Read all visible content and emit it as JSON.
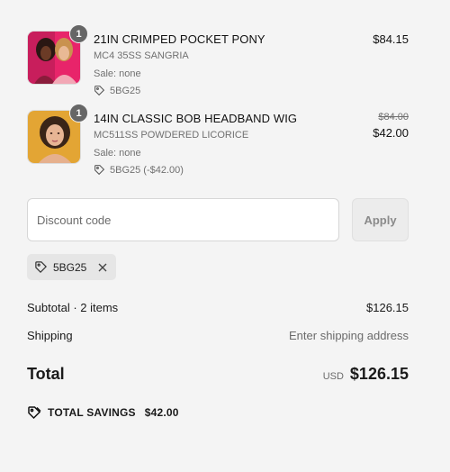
{
  "items": [
    {
      "name": "21IN CRIMPED POCKET PONY",
      "variant": "MC4 35SS SANGRIA",
      "sale": "Sale: none",
      "code": "5BG25",
      "quantity": "1",
      "price": "$84.15"
    },
    {
      "name": "14IN CLASSIC BOB HEADBAND WIG",
      "variant": "MC511SS POWDERED LICORICE",
      "sale": "Sale: none",
      "code": "5BG25 (-$42.00)",
      "quantity": "1",
      "original_price": "$84.00",
      "price": "$42.00"
    }
  ],
  "discount": {
    "placeholder": "Discount code",
    "apply_label": "Apply",
    "applied_code": "5BG25"
  },
  "summary": {
    "subtotal_label": "Subtotal · 2 items",
    "subtotal_value": "$126.15",
    "shipping_label": "Shipping",
    "shipping_value": "Enter shipping address",
    "total_label": "Total",
    "currency": "USD",
    "total_value": "$126.15",
    "savings_label": "TOTAL SAVINGS",
    "savings_value": "$42.00"
  },
  "icons": {
    "tag": "tag-icon",
    "remove": "close-icon",
    "savings": "savings-tag-icon"
  },
  "colors": {
    "background": "#f4f4f4",
    "badge": "#666666",
    "muted_text": "#707070"
  }
}
